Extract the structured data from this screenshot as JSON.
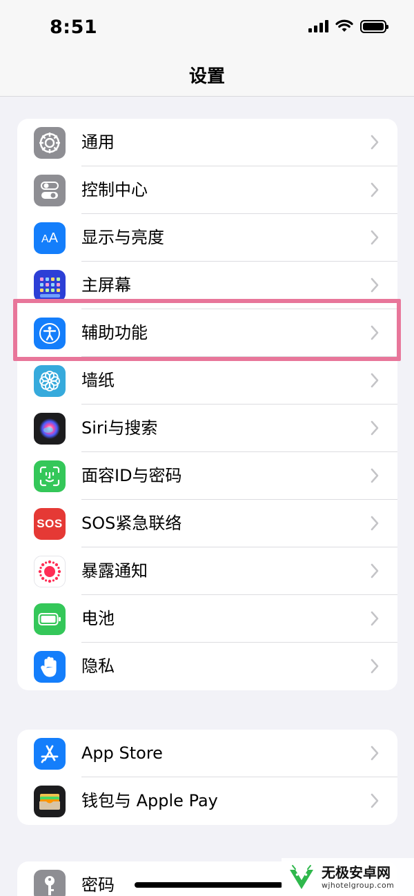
{
  "status_bar": {
    "time": "8:51"
  },
  "nav": {
    "title": "设置"
  },
  "groups": [
    {
      "items": [
        {
          "label": "通用",
          "icon": "gear-icon",
          "color": "#8e8e93"
        },
        {
          "label": "控制中心",
          "icon": "toggles-icon",
          "color": "#8e8e93"
        },
        {
          "label": "显示与亮度",
          "icon": "text-size-icon",
          "color": "#147efb"
        },
        {
          "label": "主屏幕",
          "icon": "app-grid-icon",
          "color": "#2c3fd6"
        },
        {
          "label": "辅助功能",
          "icon": "accessibility-icon",
          "color": "#147efb"
        },
        {
          "label": "墙纸",
          "icon": "flower-icon",
          "color": "#36aadc"
        },
        {
          "label": "Siri与搜索",
          "icon": "siri-icon",
          "color": "#1c1c1e"
        },
        {
          "label": "面容ID与密码",
          "icon": "face-id-icon",
          "color": "#34c759"
        },
        {
          "label": "SOS紧急联络",
          "icon": "sos-icon",
          "icon_text": "SOS",
          "color": "#e53935"
        },
        {
          "label": "暴露通知",
          "icon": "exposure-icon",
          "color": "#ffffff"
        },
        {
          "label": "电池",
          "icon": "battery-icon",
          "color": "#34c759"
        },
        {
          "label": "隐私",
          "icon": "hand-icon",
          "color": "#147efb"
        }
      ]
    },
    {
      "items": [
        {
          "label": "App Store",
          "icon": "app-store-icon",
          "color": "#147efb"
        },
        {
          "label": "钱包与 Apple Pay",
          "icon": "wallet-icon",
          "color": "#1c1c1e"
        }
      ]
    },
    {
      "items": [
        {
          "label": "密码",
          "icon": "key-icon",
          "color": "#8e8e93"
        }
      ]
    }
  ],
  "highlighted_item": "辅助功能",
  "highlight_color": "#e8769a",
  "watermark": {
    "title": "无极安卓网",
    "url": "wjhotelgroup.com"
  }
}
